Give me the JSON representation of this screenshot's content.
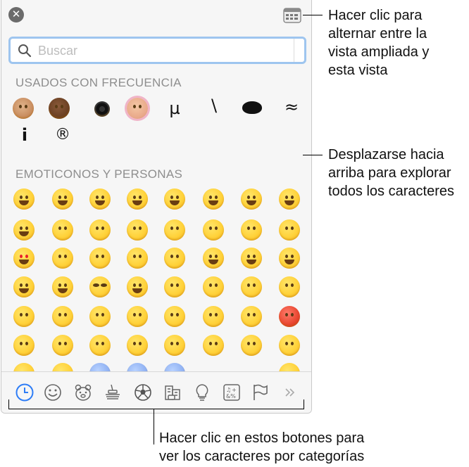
{
  "search": {
    "placeholder": "Buscar"
  },
  "sections": {
    "frequent_title": "USADOS CON FRECUENCIA",
    "emoticons_title": "EMOTICONOS Y PERSONAS"
  },
  "frequent_glyphs": [
    "µ",
    "\\",
    "≈",
    "i",
    "®"
  ],
  "category_buttons": [
    "clock-icon",
    "smiley-icon",
    "bear-icon",
    "food-icon",
    "ball-icon",
    "buildings-icon",
    "bulb-icon",
    "symbols-icon",
    "flag-icon",
    "more-icon"
  ],
  "callouts": {
    "top": [
      "Hacer clic para",
      "alternar entre la",
      "vista ampliada y",
      "esta vista"
    ],
    "middle": [
      "Desplazarse hacia",
      "arriba para explorar",
      "todos los caracteres"
    ],
    "bottom": [
      "Hacer clic en estos botones para",
      "ver los caracteres por categorías"
    ]
  },
  "colors": {
    "accent": "#2e7df6",
    "search_focus": "#9ec5ef"
  }
}
